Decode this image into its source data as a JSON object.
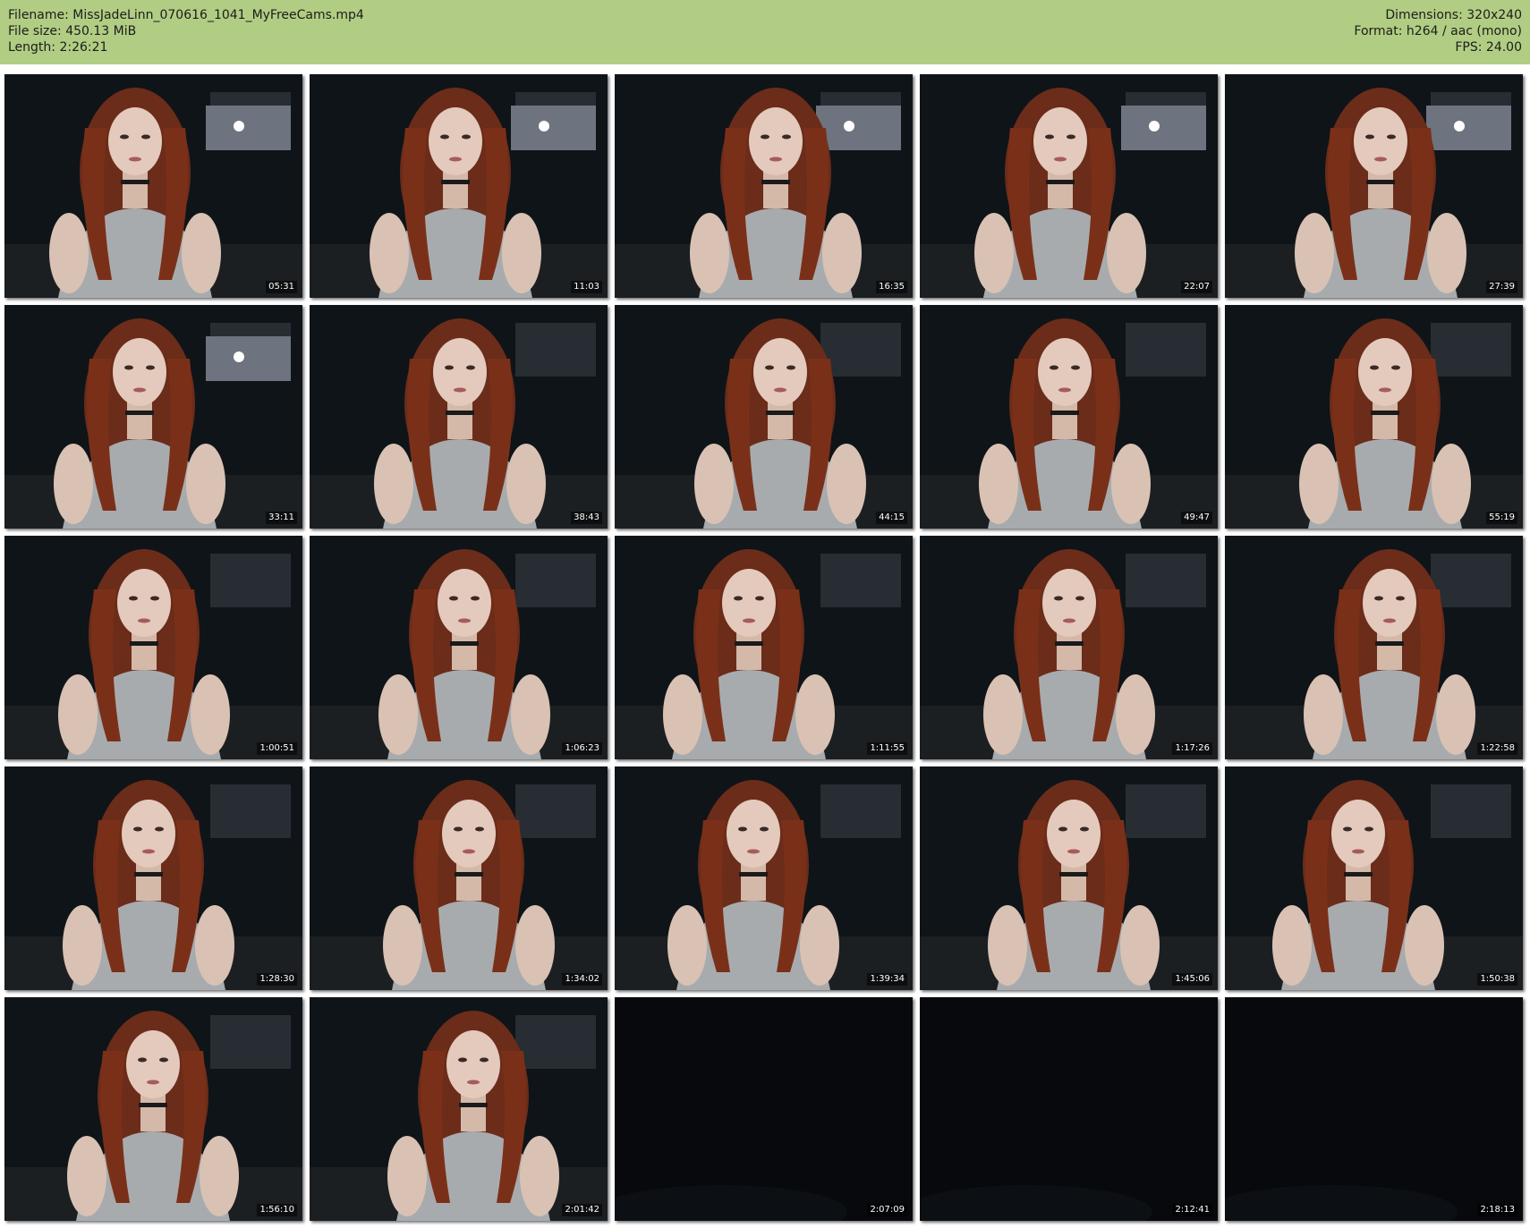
{
  "header": {
    "filename": "Filename: MissJadeLinn_070616_1041_MyFreeCams.mp4",
    "filesize": "File size: 450.13 MiB",
    "length": "Length: 2:26:21",
    "dimensions": "Dimensions: 320x240",
    "format": "Format: h264 / aac (mono)",
    "fps": "FPS: 24.00"
  },
  "colors": {
    "header_bg": "#b1cd83",
    "page_bg": "#ffffff"
  },
  "thumbnails": [
    {
      "time": "05:31",
      "scene": "person",
      "light": true
    },
    {
      "time": "11:03",
      "scene": "person",
      "light": true
    },
    {
      "time": "16:35",
      "scene": "person",
      "light": true
    },
    {
      "time": "22:07",
      "scene": "person",
      "light": true
    },
    {
      "time": "27:39",
      "scene": "person",
      "light": true
    },
    {
      "time": "33:11",
      "scene": "person",
      "light": true
    },
    {
      "time": "38:43",
      "scene": "person",
      "light": false
    },
    {
      "time": "44:15",
      "scene": "person",
      "light": false
    },
    {
      "time": "49:47",
      "scene": "person",
      "light": false
    },
    {
      "time": "55:19",
      "scene": "person",
      "light": false
    },
    {
      "time": "1:00:51",
      "scene": "person",
      "light": false
    },
    {
      "time": "1:06:23",
      "scene": "person",
      "light": false
    },
    {
      "time": "1:11:55",
      "scene": "person",
      "light": false
    },
    {
      "time": "1:17:26",
      "scene": "person",
      "light": false
    },
    {
      "time": "1:22:58",
      "scene": "person",
      "light": false
    },
    {
      "time": "1:28:30",
      "scene": "person",
      "light": false
    },
    {
      "time": "1:34:02",
      "scene": "person",
      "light": false
    },
    {
      "time": "1:39:34",
      "scene": "person",
      "light": false
    },
    {
      "time": "1:45:06",
      "scene": "person",
      "light": false
    },
    {
      "time": "1:50:38",
      "scene": "person",
      "light": false
    },
    {
      "time": "1:56:10",
      "scene": "person",
      "light": false
    },
    {
      "time": "2:01:42",
      "scene": "person",
      "light": false
    },
    {
      "time": "2:07:09",
      "scene": "dark",
      "light": false
    },
    {
      "time": "2:12:41",
      "scene": "dark",
      "light": false
    },
    {
      "time": "2:18:13",
      "scene": "dark",
      "light": false
    }
  ]
}
